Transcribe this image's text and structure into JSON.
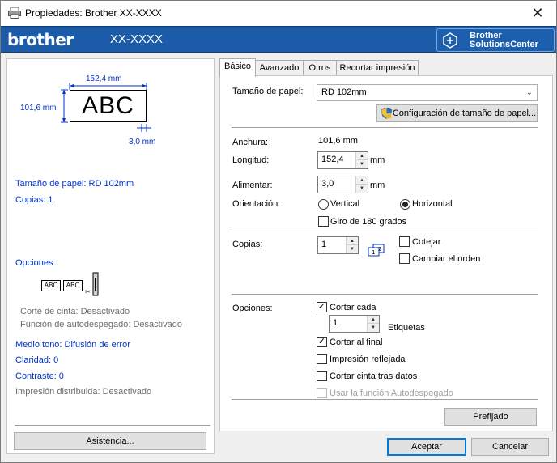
{
  "window": {
    "title": "Propiedades: Brother  XX-XXXX",
    "close_glyph": "✕"
  },
  "banner": {
    "logo": "brother",
    "model": "XX-XXXX",
    "solutions_line1": "Brother",
    "solutions_line2": "SolutionsCenter"
  },
  "preview": {
    "width_dim": "152,4 mm",
    "height_dim": "101,6 mm",
    "margin_dim": "3,0 mm",
    "label_text": "ABC"
  },
  "summary": {
    "paper_size": "Tamaño de papel: RD 102mm",
    "copies": "Copias: 1",
    "options_title": "Opciones:",
    "abc1": "ABC",
    "abc2": "ABC",
    "cut_tape": "Corte de cinta: Desactivado",
    "auto_peel": "Función de autodespegado: Desactivado",
    "halftone": "Medio tono: Difusión de error",
    "brightness": "Claridad:   0",
    "contrast": "Contraste:   0",
    "distributed": "Impresión distribuida: Desactivado"
  },
  "buttons": {
    "help": "Asistencia...",
    "accept": "Aceptar",
    "cancel": "Cancelar",
    "default": "Prefijado"
  },
  "tabs": [
    "Básico",
    "Avanzado",
    "Otros",
    "Recortar impresión"
  ],
  "basic": {
    "paper_size_label": "Tamaño de papel:",
    "paper_size_value": "RD 102mm",
    "paper_config_button": "Configuración de tamaño de papel...",
    "width_label": "Anchura:",
    "width_value": "101,6 mm",
    "length_label": "Longitud:",
    "length_value": "152,4",
    "length_unit": "mm",
    "feed_label": "Alimentar:",
    "feed_value": "3,0",
    "feed_unit": "mm",
    "orientation_label": "Orientación:",
    "vertical": "Vertical",
    "horizontal": "Horizontal",
    "rotate180": "Giro de 180 grados",
    "copies_label": "Copias:",
    "copies_value": "1",
    "collate": "Cotejar",
    "reverse_order": "Cambiar el orden",
    "options_label": "Opciones:",
    "cut_every": "Cortar cada",
    "cut_every_value": "1",
    "labels_unit": "Etiquetas",
    "cut_at_end": "Cortar al final",
    "mirror_print": "Impresión reflejada",
    "cut_tape_after": "Cortar cinta tras datos",
    "use_auto_peel": "Usar la función Autodespegado"
  },
  "colors": {
    "banner": "#1b5ba8",
    "summary_text": "#0033cc"
  }
}
